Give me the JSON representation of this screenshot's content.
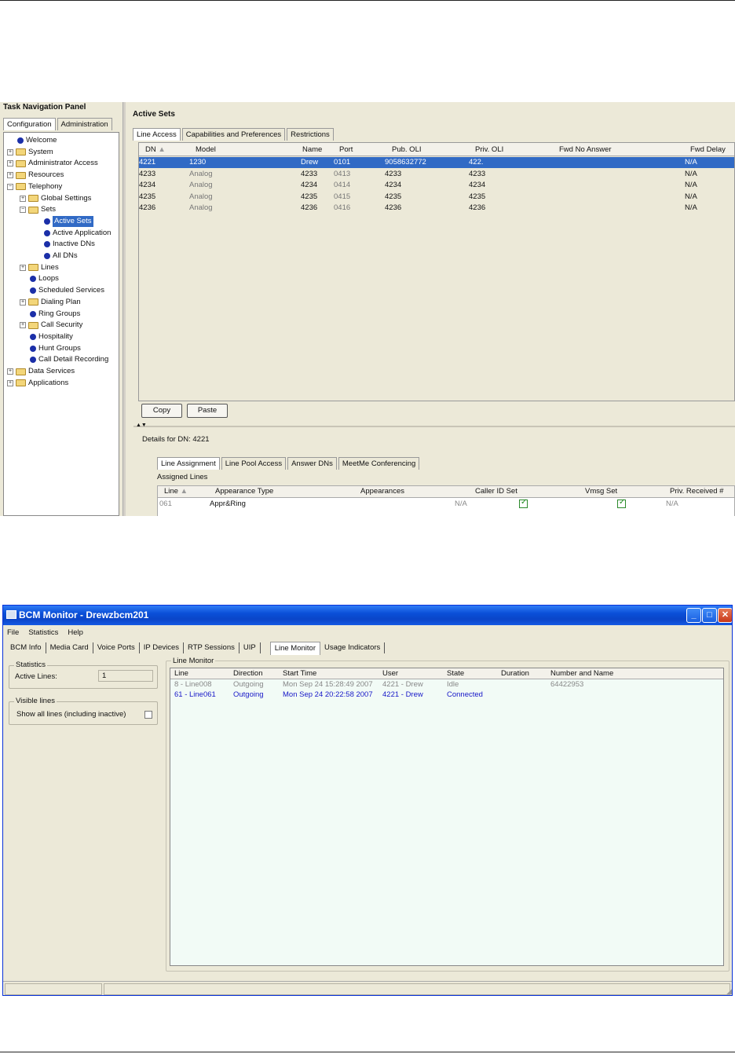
{
  "screenshot1": {
    "nav": {
      "title": "Task Navigation Panel",
      "tabs": [
        "Configuration",
        "Administration"
      ],
      "tree": [
        {
          "label": "Welcome",
          "type": "leaf",
          "level": 0
        },
        {
          "label": "System",
          "type": "folder",
          "level": 0
        },
        {
          "label": "Administrator Access",
          "type": "folder",
          "level": 0
        },
        {
          "label": "Resources",
          "type": "folder",
          "level": 0
        },
        {
          "label": "Telephony",
          "type": "folder",
          "level": 0,
          "expanded": true
        },
        {
          "label": "Global Settings",
          "type": "folder",
          "level": 1
        },
        {
          "label": "Sets",
          "type": "folder",
          "level": 1,
          "expanded": true
        },
        {
          "label": "Active Sets",
          "type": "leaf",
          "level": 2,
          "selected": true
        },
        {
          "label": "Active Application",
          "type": "leaf",
          "level": 2
        },
        {
          "label": "Inactive DNs",
          "type": "leaf",
          "level": 2
        },
        {
          "label": "All DNs",
          "type": "leaf",
          "level": 2
        },
        {
          "label": "Lines",
          "type": "folder",
          "level": 1
        },
        {
          "label": "Loops",
          "type": "leaf",
          "level": 1
        },
        {
          "label": "Scheduled Services",
          "type": "leaf",
          "level": 1
        },
        {
          "label": "Dialing Plan",
          "type": "folder",
          "level": 1
        },
        {
          "label": "Ring Groups",
          "type": "leaf",
          "level": 1
        },
        {
          "label": "Call Security",
          "type": "folder",
          "level": 1
        },
        {
          "label": "Hospitality",
          "type": "leaf",
          "level": 1
        },
        {
          "label": "Hunt Groups",
          "type": "leaf",
          "level": 1
        },
        {
          "label": "Call Detail Recording",
          "type": "leaf",
          "level": 1
        },
        {
          "label": "Data Services",
          "type": "folder",
          "level": 0
        },
        {
          "label": "Applications",
          "type": "folder",
          "level": 0
        }
      ]
    },
    "main": {
      "heading": "Active Sets",
      "tabs": [
        "Line Access",
        "Capabilities and Preferences",
        "Restrictions"
      ],
      "columns": [
        "DN",
        "Model",
        "Name",
        "Port",
        "Pub. OLI",
        "Priv. OLI",
        "Fwd No Answer",
        "Fwd Delay"
      ],
      "rows": [
        [
          "4221",
          "1230",
          "Drew",
          "0101",
          "9058632772",
          "422.",
          "",
          "N/A"
        ],
        [
          "4233",
          "Analog",
          "4233",
          "0413",
          "4233",
          "4233",
          "",
          "N/A"
        ],
        [
          "4234",
          "Analog",
          "4234",
          "0414",
          "4234",
          "4234",
          "",
          "N/A"
        ],
        [
          "4235",
          "Analog",
          "4235",
          "0415",
          "4235",
          "4235",
          "",
          "N/A"
        ],
        [
          "4236",
          "Analog",
          "4236",
          "0416",
          "4236",
          "4236",
          "",
          "N/A"
        ]
      ],
      "copy_label": "Copy",
      "paste_label": "Paste",
      "details_label": "Details for DN: 4221",
      "detail_tabs": [
        "Line Assignment",
        "Line Pool Access",
        "Answer DNs",
        "MeetMe Conferencing"
      ],
      "assigned_label": "Assigned Lines",
      "assigned_columns": [
        "Line",
        "Appearance Type",
        "Appearances",
        "Caller ID Set",
        "Vmsg Set",
        "Priv. Received #"
      ],
      "assigned_rows": [
        {
          "line": "061",
          "appearance_type": "Appr&Ring",
          "appearances": "N/A",
          "caller_id_set": true,
          "vmsg_set": true,
          "priv_received": "N/A"
        }
      ]
    }
  },
  "screenshot2": {
    "title": "BCM Monitor - Drewzbcm201",
    "menu": [
      "File",
      "Statistics",
      "Help"
    ],
    "tabs": [
      "BCM Info",
      "Media Card",
      "Voice Ports",
      "IP Devices",
      "RTP Sessions",
      "UIP",
      "Line Monitor",
      "Usage Indicators"
    ],
    "active_tab": "Line Monitor",
    "statistics": {
      "label": "Statistics",
      "active_lines_label": "Active Lines:",
      "active_lines_value": "1"
    },
    "visible_lines": {
      "label": "Visible lines",
      "show_all_label": "Show all lines (including inactive)"
    },
    "line_monitor": {
      "label": "Line Monitor",
      "columns": [
        "Line",
        "Direction",
        "Start Time",
        "User",
        "State",
        "Duration",
        "Number and Name"
      ],
      "rows": [
        {
          "line": "8 - Line008",
          "direction": "Outgoing",
          "start_time": "Mon Sep 24 15:28:49 2007",
          "user": "4221 - Drew",
          "state": "Idle",
          "duration": "",
          "number_name": "64422953",
          "status": "idle"
        },
        {
          "line": "61 - Line061",
          "direction": "Outgoing",
          "start_time": "Mon Sep 24 20:22:58 2007",
          "user": "4221 - Drew",
          "state": "Connected",
          "duration": "",
          "number_name": "",
          "status": "connected"
        }
      ]
    }
  }
}
